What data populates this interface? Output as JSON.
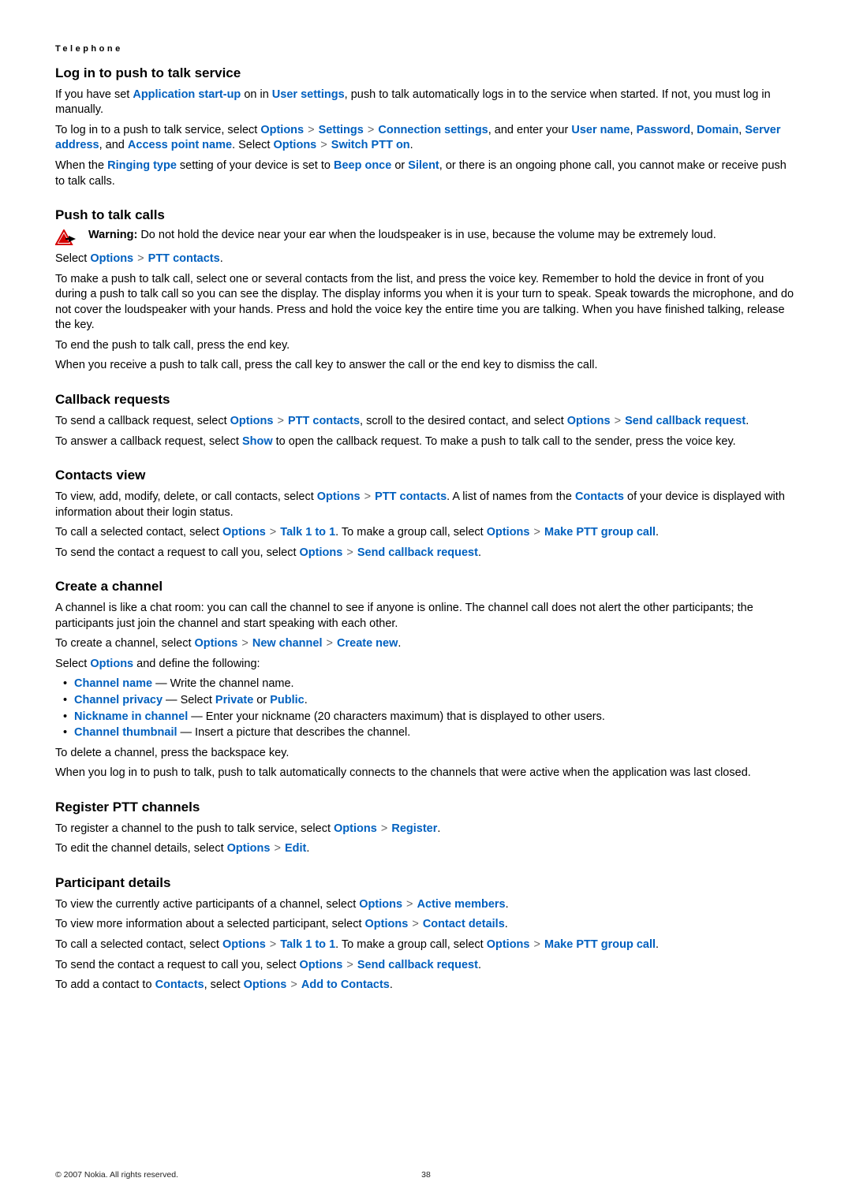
{
  "chapter": "Telephone",
  "footer": {
    "copyright": "© 2007 Nokia. All rights reserved.",
    "page": "38"
  },
  "sec_login": {
    "h": "Log in to push to talk service",
    "p1a": "If you have set ",
    "p1_opt1": "Application start-up",
    "p1b": " on in ",
    "p1_opt2": "User settings",
    "p1c": ", push to talk automatically logs in to the service when started. If not, you must log in manually.",
    "p2a": "To log in to a push to talk service, select ",
    "p2_opt1": "Options",
    "p2_opt2": "Settings",
    "p2_opt3": "Connection settings",
    "p2b": ", and enter your ",
    "p2_opt4": "User name",
    "p2_opt5": "Password",
    "p2_opt6": "Domain",
    "p2_opt7": "Server address",
    "p2_opt8": "Access point name",
    "p2c": ". Select ",
    "p2_opt9": "Options",
    "p2_opt10": "Switch PTT on",
    "p3a": "When the ",
    "p3_opt1": "Ringing type",
    "p3b": " setting of your device is set to ",
    "p3_opt2": "Beep once",
    "p3_opt3": "Silent",
    "p3c": ", or there is an ongoing phone call, you cannot make or receive push to talk calls."
  },
  "sec_calls": {
    "h": "Push to talk calls",
    "warn_label": "Warning:  ",
    "warn_body": "Do not hold the device near your ear when the loudspeaker is in use, because the volume may be extremely loud.",
    "sel_a": "Select ",
    "sel_opt1": "Options",
    "sel_opt2": "PTT contacts",
    "p1": "To make a push to talk call, select one or several contacts from the list, and press the voice key. Remember to hold the device in front of you during a push to talk call so you can see the display. The display informs you when it is your turn to speak. Speak towards the microphone, and do not cover the loudspeaker with your hands. Press and hold the voice key the entire time you are talking. When you have finished talking, release the key.",
    "p2": "To end the push to talk call, press the end key.",
    "p3": "When you receive a push to talk call, press the call key to answer the call or the end key to dismiss the call."
  },
  "sec_cb": {
    "h": "Callback requests",
    "p1a": "To send a callback request, select ",
    "p1_opt1": "Options",
    "p1_opt2": "PTT contacts",
    "p1b": ", scroll to the desired contact, and select ",
    "p1_opt3": "Options",
    "p1_opt4": "Send callback request",
    "p2a": "To answer a callback request, select ",
    "p2_opt1": "Show",
    "p2b": " to open the callback request. To make a push to talk call to the sender, press the voice key."
  },
  "sec_cv": {
    "h": "Contacts view",
    "p1a": "To view, add, modify, delete, or call contacts, select ",
    "p1_opt1": "Options",
    "p1_opt2": "PTT contacts",
    "p1b": ". A list of names from the ",
    "p1_opt3": "Contacts",
    "p1c": " of your device is displayed with information about their login status.",
    "p2a": "To call a selected contact, select ",
    "p2_opt1": "Options",
    "p2_opt2": "Talk 1 to 1",
    "p2b": ". To make a group call, select ",
    "p2_opt3": "Options",
    "p2_opt4": "Make PTT group call",
    "p3a": "To send the contact a request to call you, select ",
    "p3_opt1": "Options",
    "p3_opt2": "Send callback request"
  },
  "sec_ch": {
    "h": "Create a channel",
    "p1": "A channel is like a chat room: you can call the channel to see if anyone is online. The channel call does not alert the other participants; the participants just join the channel and start speaking with each other.",
    "p2a": "To create a channel, select ",
    "p2_opt1": "Options",
    "p2_opt2": "New channel",
    "p2_opt3": "Create new",
    "p3a": "Select ",
    "p3_opt1": "Options",
    "p3b": " and define the following:",
    "li1_opt": "Channel name",
    "li1_txt": "  — Write the channel name.",
    "li2_opt": "Channel privacy",
    "li2_txt_a": "  — Select ",
    "li2_opt2": "Private",
    "li2_txt_b": " or ",
    "li2_opt3": "Public",
    "li3_opt": "Nickname in channel",
    "li3_txt": "  — Enter your nickname (20 characters maximum) that is displayed to other users.",
    "li4_opt": "Channel thumbnail",
    "li4_txt": "  — Insert a picture that describes the channel.",
    "p4": "To delete a channel, press the backspace key.",
    "p5": "When you log in to push to talk, push to talk automatically connects to the channels that were active when the application was last closed."
  },
  "sec_reg": {
    "h": "Register PTT channels",
    "p1a": "To register a channel to the push to talk service, select ",
    "p1_opt1": "Options",
    "p1_opt2": "Register",
    "p2a": "To edit the channel details, select ",
    "p2_opt1": "Options",
    "p2_opt2": "Edit"
  },
  "sec_pd": {
    "h": "Participant details",
    "p1a": "To view the currently active participants of a channel, select ",
    "p1_opt1": "Options",
    "p1_opt2": "Active members",
    "p2a": "To view more information about a selected participant, select ",
    "p2_opt1": "Options",
    "p2_opt2": "Contact details",
    "p3a": "To call a selected contact, select ",
    "p3_opt1": "Options",
    "p3_opt2": "Talk 1 to 1",
    "p3b": ". To make a group call, select ",
    "p3_opt3": "Options",
    "p3_opt4": "Make PTT group call",
    "p4a": "To send the contact a request to call you, select ",
    "p4_opt1": "Options",
    "p4_opt2": "Send callback request",
    "p5a": "To add a contact to ",
    "p5_opt1": "Contacts",
    "p5b": ", select ",
    "p5_opt2": "Options",
    "p5_opt3": "Add to Contacts"
  }
}
